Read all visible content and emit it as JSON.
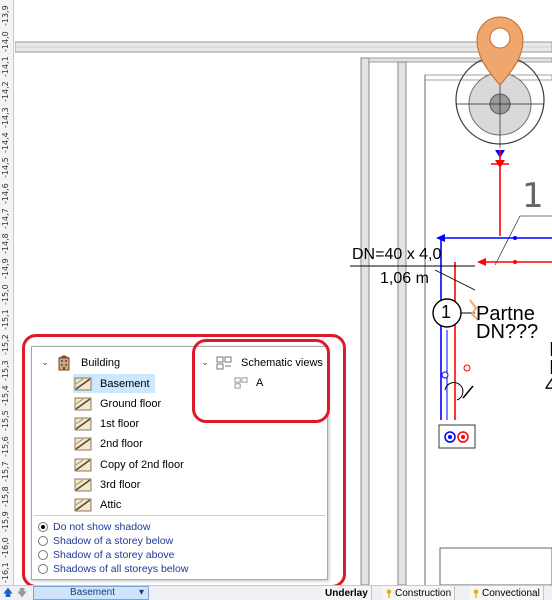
{
  "ruler": {
    "labels": [
      "-16,1",
      "-16,0",
      "-15,9",
      "-15,8",
      "-15,7",
      "-15,6",
      "-15,5",
      "-15,4",
      "-15,3",
      "-15,2",
      "-15,1",
      "-15,0",
      "-14,9",
      "-14,8",
      "-14,7",
      "-14,6",
      "-14,5",
      "-14,4",
      "-14,3",
      "-14,2",
      "-14,1",
      "-14,0",
      "-13,9"
    ]
  },
  "drawing": {
    "pipe_dim_label": "DN=40 x 4,0",
    "pipe_length_label": "1,06 m",
    "node_number": "1",
    "tag_number": "1",
    "partner_text_line1": "Partne",
    "partner_text_line2": "DN???",
    "partner_text_line3": "I",
    "partner_text_line4": "I",
    "partner_text_line5": "4"
  },
  "panel": {
    "building": {
      "label": "Building",
      "icon": "building-icon",
      "storeys": [
        "Basement",
        "Ground floor",
        "1st floor",
        "2nd floor",
        "Copy of 2nd floor",
        "3rd floor",
        "Attic"
      ],
      "selected": "Basement"
    },
    "schematic": {
      "label": "Schematic views",
      "icon": "schematic-views-icon",
      "items": [
        "A"
      ]
    },
    "shadow_options": [
      "Do not show shadow",
      "Shadow of a storey below",
      "Shadow of a storey above",
      "Shadows of all storeys below"
    ],
    "shadow_selected": "Do not show shadow"
  },
  "bottombar": {
    "storey_selector": "Basement",
    "tabs": [
      "Underlay",
      "Construction",
      "Convectional"
    ]
  },
  "colors": {
    "annotation_red": "#e0192a",
    "selection_blue": "#cce8ff",
    "marker_orange": "#f0a76e",
    "pipe_red": "#ff0000",
    "pipe_blue": "#0000ff"
  }
}
